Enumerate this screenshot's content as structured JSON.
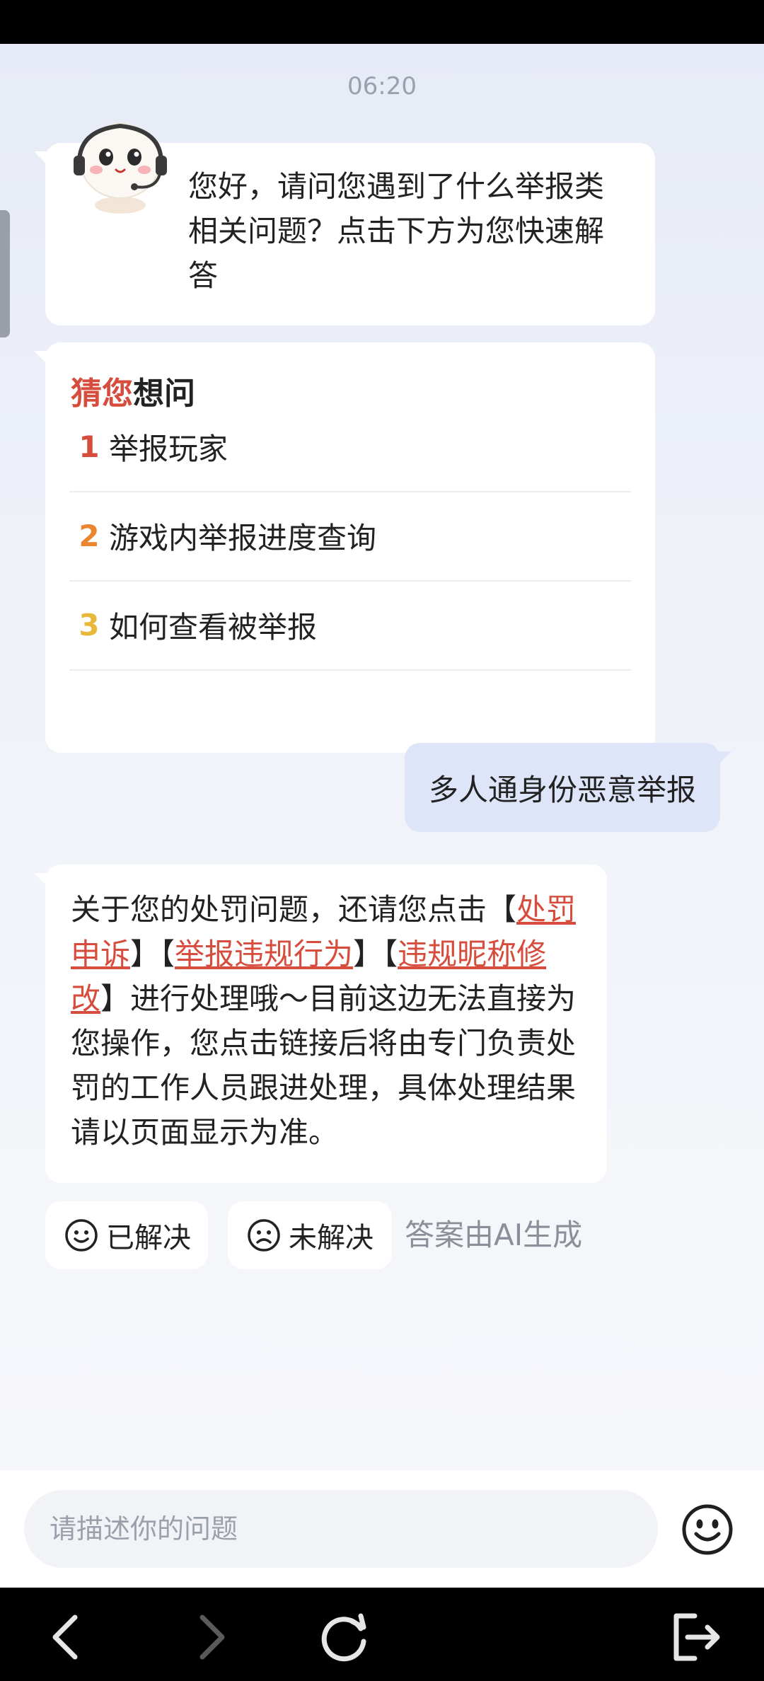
{
  "chat": {
    "timestamp": "06:20",
    "greeting": "您好，请问您遇到了什么举报类相关问题？点击下方为您快速解答",
    "guess": {
      "title_highlight": "猜您",
      "title_rest": "想问",
      "questions": [
        {
          "num": "1",
          "text": "举报玩家",
          "color": "#d64d3e"
        },
        {
          "num": "2",
          "text": "游戏内举报进度查询",
          "color": "#e9862f"
        },
        {
          "num": "3",
          "text": "如何查看被举报",
          "color": "#e8b83a"
        }
      ]
    },
    "user_message": "多人通身份恶意举报",
    "answer": {
      "intro": "关于您的处罚问题，还请您点击",
      "bracket_open": "【",
      "bracket_close": "】",
      "link1": "处罚申诉",
      "link2": "举报违规行为",
      "link3": "违规昵称修改",
      "outro": "进行处理哦～目前这边无法直接为您操作，您点击链接后将由专门负责处罚的工作人员跟进处理，具体处理结果请以页面显示为准。"
    },
    "feedback": {
      "resolved_label": "已解决",
      "unresolved_label": "未解决",
      "ai_note": "答案由AI生成"
    }
  },
  "input": {
    "placeholder": "请描述你的问题",
    "value": ""
  },
  "icons": {
    "emoji": "smiley-icon",
    "nav_back": "back-arrow-icon",
    "nav_forward": "forward-arrow-icon",
    "nav_refresh": "refresh-icon",
    "nav_exit": "exit-icon"
  },
  "colors": {
    "accent": "#d64d3e",
    "user_bubble": "#dfe5f8"
  }
}
